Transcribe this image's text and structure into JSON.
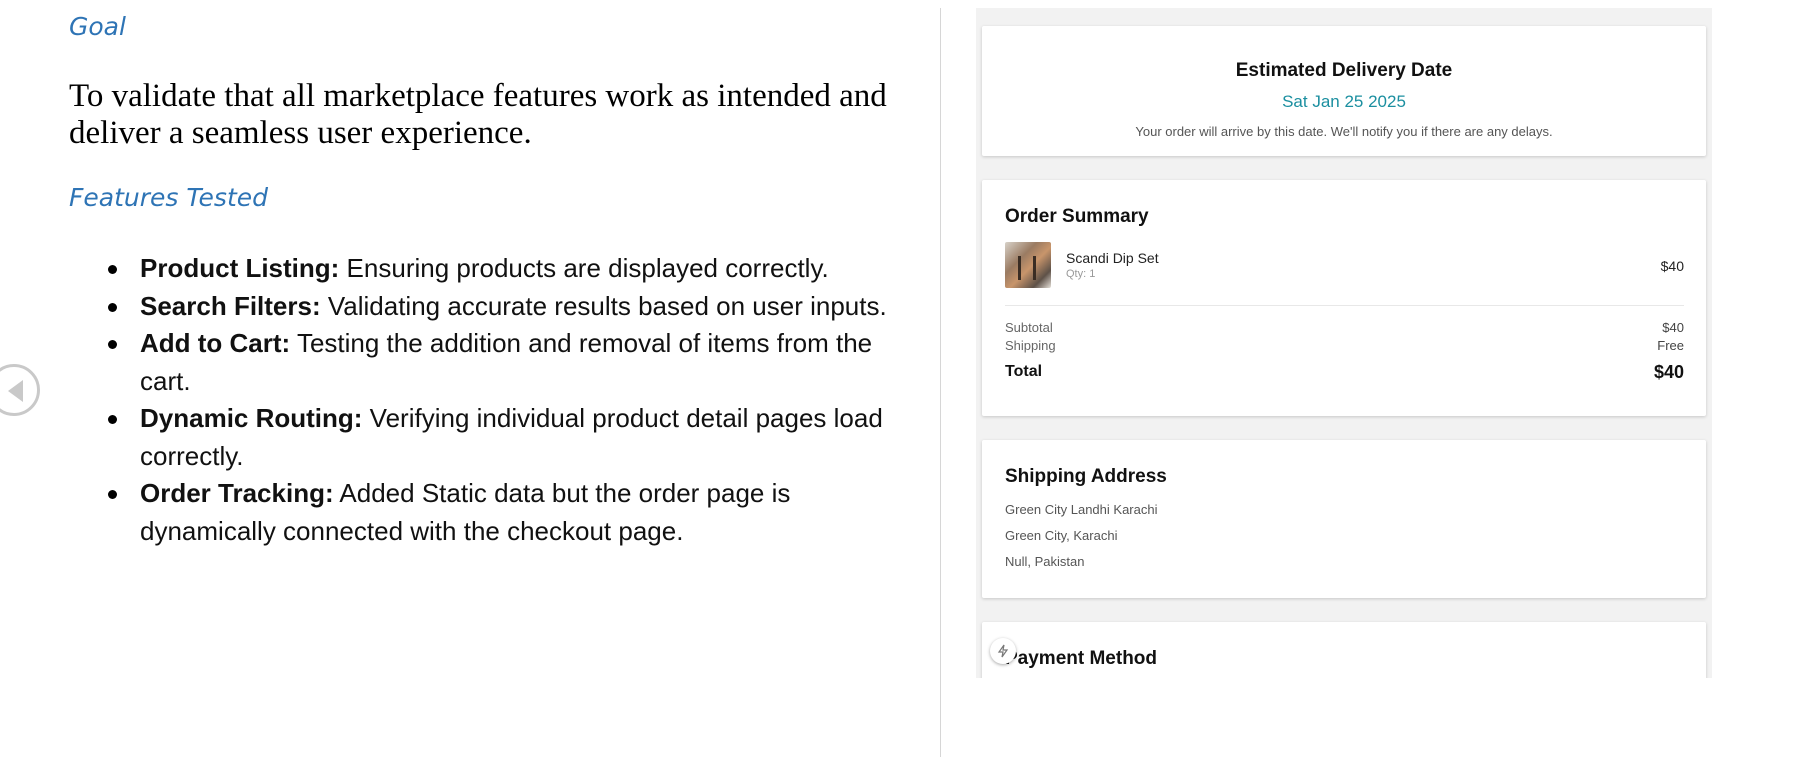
{
  "document": {
    "goal_heading": "Goal",
    "goal_text": "To validate that all marketplace features work as intended and deliver a seamless user experience.",
    "features_heading": "Features Tested",
    "features": [
      {
        "term": "Product Listing:",
        "text": " Ensuring products are displayed correctly."
      },
      {
        "term": "Search Filters:",
        "text": " Validating accurate results based on user inputs."
      },
      {
        "term": "Add to Cart:",
        "text": " Testing the addition and removal of items from the cart."
      },
      {
        "term": "Dynamic Routing:",
        "text": " Verifying individual product detail pages load correctly."
      },
      {
        "term": "Order Tracking:",
        "text": " Added Static data but the order page is dynamically connected with the checkout page."
      }
    ]
  },
  "nav": {
    "icon": "chevron-left-circle-icon"
  },
  "order_page": {
    "delivery": {
      "title": "Estimated Delivery Date",
      "date": "Sat Jan 25 2025",
      "note": "Your order will arrive by this date. We'll notify you if there are any delays."
    },
    "summary": {
      "title": "Order Summary",
      "item": {
        "name": "Scandi Dip Set",
        "qty": "Qty: 1",
        "price": "$40"
      },
      "subtotal_label": "Subtotal",
      "subtotal_value": "$40",
      "shipping_label": "Shipping",
      "shipping_value": "Free",
      "total_label": "Total",
      "total_value": "$40"
    },
    "shipping_address": {
      "title": "Shipping Address",
      "lines": [
        "Green City Landhi Karachi",
        "Green City, Karachi",
        "Null, Pakistan"
      ]
    },
    "payment": {
      "title": "Payment Method",
      "badge_icon": "bolt-icon"
    }
  },
  "colors": {
    "heading_blue": "#2e74b5",
    "date_teal": "#1b8fa0"
  }
}
